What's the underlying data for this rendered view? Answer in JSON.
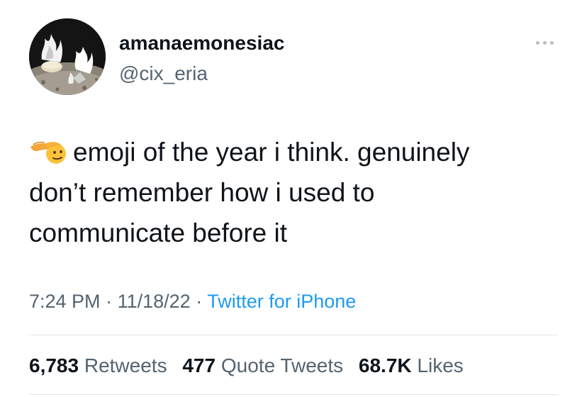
{
  "user": {
    "display_name": "amanaemonesiac",
    "handle": "@cix_eria",
    "avatar_icon": "avatar-image"
  },
  "tweet": {
    "emoji_icon": "saluting-face-emoji",
    "lines": [
      "emoji of the year i think. genuinely",
      "don’t remember how i used to",
      "communicate before it"
    ]
  },
  "meta": {
    "time": "7:24 PM",
    "separator": "·",
    "date": "11/18/22",
    "source": "Twitter for iPhone"
  },
  "stats": {
    "retweets_count": "6,783",
    "retweets_label": "Retweets",
    "quotes_count": "477",
    "quotes_label": "Quote Tweets",
    "likes_count": "68.7K",
    "likes_label": "Likes"
  },
  "colors": {
    "text": "#0f1419",
    "secondary": "#536471",
    "link": "#1d9bf0",
    "divider": "#e1e6ea"
  }
}
